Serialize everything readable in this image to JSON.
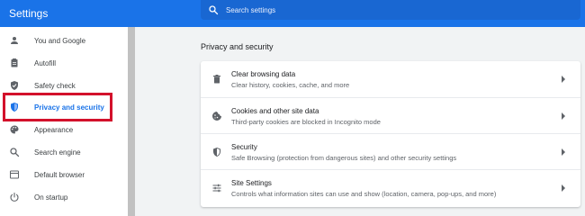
{
  "header": {
    "title": "Settings",
    "search_placeholder": "Search settings"
  },
  "sidebar": {
    "items": [
      {
        "label": "You and Google",
        "icon": "person-icon"
      },
      {
        "label": "Autofill",
        "icon": "clipboard-icon"
      },
      {
        "label": "Safety check",
        "icon": "shield-check-icon"
      },
      {
        "label": "Privacy and security",
        "icon": "shield-icon",
        "active": true
      },
      {
        "label": "Appearance",
        "icon": "palette-icon"
      },
      {
        "label": "Search engine",
        "icon": "search-icon"
      },
      {
        "label": "Default browser",
        "icon": "browser-icon"
      },
      {
        "label": "On startup",
        "icon": "power-icon"
      }
    ]
  },
  "main": {
    "section_title": "Privacy and security",
    "rows": [
      {
        "title": "Clear browsing data",
        "description": "Clear history, cookies, cache, and more",
        "icon": "trash-icon"
      },
      {
        "title": "Cookies and other site data",
        "description": "Third-party cookies are blocked in Incognito mode",
        "icon": "cookie-icon"
      },
      {
        "title": "Security",
        "description": "Safe Browsing (protection from dangerous sites) and other security settings",
        "icon": "shield-icon"
      },
      {
        "title": "Site Settings",
        "description": "Controls what information sites can use and show (location, camera, pop-ups, and more)",
        "icon": "tune-icon"
      }
    ]
  },
  "colors": {
    "accent": "#1a73e8",
    "highlight_outline": "#d3112b"
  }
}
